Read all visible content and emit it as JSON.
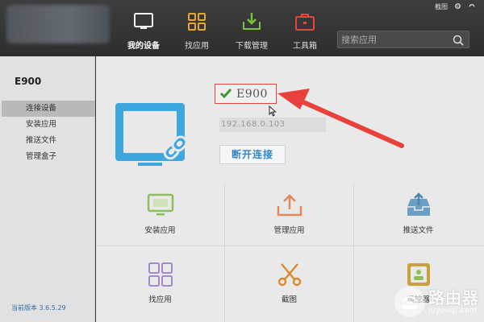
{
  "header": {
    "nav": [
      {
        "label": "我的设备",
        "icon": "device-icon"
      },
      {
        "label": "找应用",
        "icon": "grid-icon"
      },
      {
        "label": "下载管理",
        "icon": "download-icon"
      },
      {
        "label": "工具箱",
        "icon": "toolbox-icon"
      }
    ],
    "sys_label": "截图",
    "search_placeholder": "搜索应用"
  },
  "sidebar": {
    "device_name": "E900",
    "items": [
      {
        "label": "连接设备",
        "active": true
      },
      {
        "label": "安装应用",
        "active": false
      },
      {
        "label": "推送文件",
        "active": false
      },
      {
        "label": "管理盒子",
        "active": false
      }
    ],
    "version": "当前版本 3.6.5.29"
  },
  "device": {
    "name": "E900",
    "ip": "192.168.0.103",
    "disconnect_label": "断开连接"
  },
  "actions": [
    {
      "label": "安装应用",
      "icon": "monitor-icon"
    },
    {
      "label": "管理应用",
      "icon": "upload-icon"
    },
    {
      "label": "推送文件",
      "icon": "tray-upload-icon"
    },
    {
      "label": "找应用",
      "icon": "grid-icon"
    },
    {
      "label": "截图",
      "icon": "scissors-icon"
    },
    {
      "label": "遥控器",
      "icon": "remote-icon"
    }
  ],
  "watermark": {
    "cn": "路由器",
    "en": "luyouqi.com"
  },
  "colors": {
    "accent": "#2d86c9",
    "highlight": "#e0463c",
    "green": "#6fae3a",
    "orange": "#e08a3a",
    "purple": "#a38bc9",
    "gold": "#c9a23a"
  }
}
